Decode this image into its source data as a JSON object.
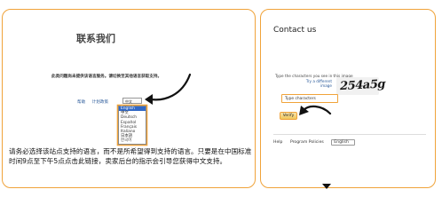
{
  "left": {
    "title": "联系我们",
    "notice": "此类问题尚未提供该语言服务。请切换至其他语言获取支持。",
    "nav_items": [
      "帮助",
      "计划政策"
    ],
    "language_select": "中文",
    "language_options": [
      "English",
      "中文",
      "Deutsch",
      "Español",
      "Français",
      "Italiano",
      "日本語",
      "한국어"
    ],
    "selected_option": "English",
    "chinese_text": "请务必选择该站点支持的语言，而不是所希望得到支持的语言。只要是在中国标准时间9点至下午5点点击此链接，卖家后台的指示会引导您获得中文支持。"
  },
  "right": {
    "title": "Contact us",
    "captcha_label": "Type the characters you see in this image",
    "captcha_links": [
      "Try a different",
      "image"
    ],
    "captcha_text": "254a5g",
    "input_placeholder": "Type characters",
    "verify_label": "Verify",
    "footer_items": [
      "Help",
      "Program Policies"
    ],
    "footer_language": "English"
  },
  "colors": {
    "highlight": "#f0a33a",
    "selected_option": "#3168c5",
    "link": "#2a5a9a"
  }
}
